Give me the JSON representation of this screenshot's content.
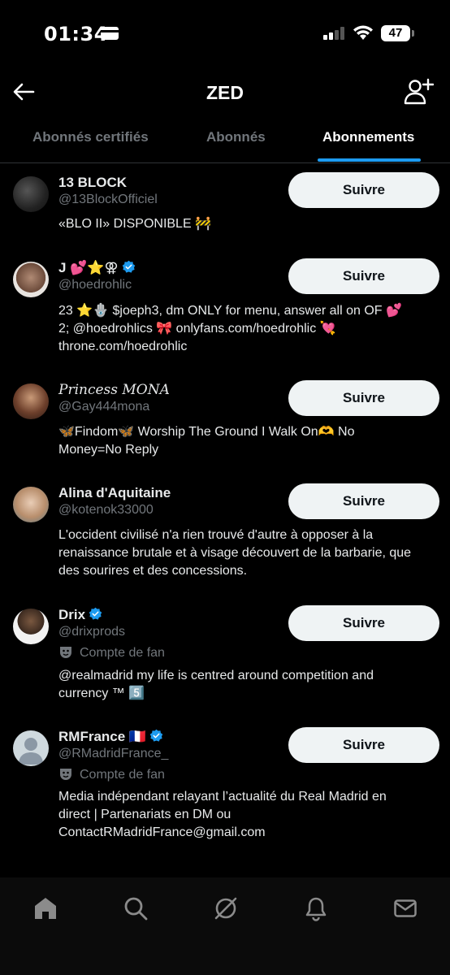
{
  "status": {
    "time": "01:34",
    "battery": "47"
  },
  "header": {
    "title": "ZED"
  },
  "tabs": [
    {
      "label": "Abonnés certifiés"
    },
    {
      "label": "Abonnés"
    },
    {
      "label": "Abonnements"
    }
  ],
  "follow_label": "Suivre",
  "users": [
    {
      "name": "13 BLOCK",
      "handle": "@13BlockOfficiel",
      "bio": [
        "«BLO II» DISPONIBLE 🚧"
      ]
    },
    {
      "name": "J 💕⭐⚢",
      "handle": "@hoedrohlic",
      "verified": true,
      "bio": [
        "23 ⭐🪬 $joeph3, dm ONLY for menu, answer all on OF 💕",
        "2; @hoedrohlics 🎀 onlyfans.com/hoedrohlic 💘",
        "throne.com/hoedrohlic"
      ]
    },
    {
      "name": "𝑃𝑟𝑖𝑛𝑐𝑒𝑠𝑠 𝑀𝑂𝑁𝐴",
      "handle": "@Gay444mona",
      "bio": [
        "🦋Findom🦋 Worship The Ground I Walk On🫶 No",
        "Money=No Reply"
      ]
    },
    {
      "name": "Alina d'Aquitaine",
      "handle": "@kotenok33000",
      "bio": [
        "L'occident civilisé n'a rien trouvé d'autre à opposer à la",
        "renaissance brutale et à visage découvert de la barbarie, que",
        "des sourires et des concessions."
      ]
    },
    {
      "name": "Drix",
      "handle": "@drixprods",
      "verified": true,
      "badge": "Compte de fan",
      "bio": [
        "@realmadrid my life is centred around competition and",
        "currency ™ 5️⃣"
      ]
    },
    {
      "name": "RMFrance 🇫🇷",
      "handle": "@RMadridFrance_",
      "verified": true,
      "badge": "Compte de fan",
      "bio": [
        "Media indépendant relayant l’actualité du Real Madrid en",
        "direct | Partenariats en DM ou",
        "ContactRMadridFrance@gmail.com"
      ]
    }
  ],
  "colors": {
    "accent": "#1d9bf0",
    "background": "#000000",
    "muted": "#71767b"
  }
}
